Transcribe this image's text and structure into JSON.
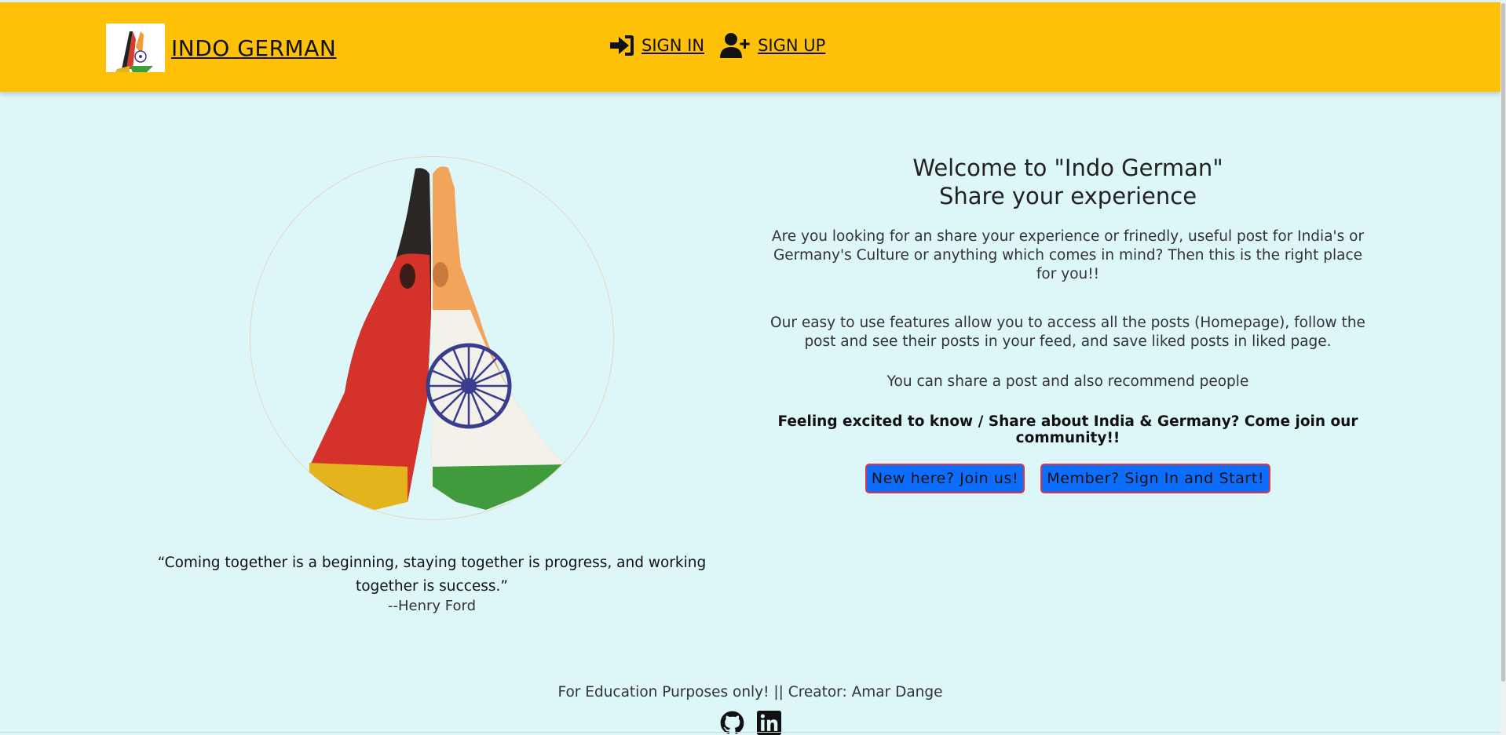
{
  "brand": {
    "name": "INDO GERMAN"
  },
  "nav": {
    "sign_in": "SIGN IN",
    "sign_up": "SIGN UP"
  },
  "quote": {
    "text": "“Coming together is a beginning, staying together is progress, and working together is success.”",
    "author": "--Henry Ford"
  },
  "welcome": {
    "line1": "Welcome to \"Indo German\"",
    "line2": "Share your experience",
    "intro": "Are you looking for an share your experience or frinedly, useful post for India's or Germany's Culture or anything which comes in mind? Then this is the right place for you!!",
    "features": "Our easy to use features allow you to access all the posts (Homepage), follow the post and see their posts in your feed, and save liked posts in liked page.",
    "share": "You can share a post and also recommend people",
    "excited": "Feeling excited to know / Share about India & Germany? Come join our community!!"
  },
  "buttons": {
    "join": "New here? Join us!",
    "signin": "Member? Sign In and Start!"
  },
  "footer": {
    "text": "For Education Purposes only! || Creator: Amar Dange"
  },
  "colors": {
    "navbar": "#ffc107",
    "background": "#ddf6f8",
    "button": "#0d6efd",
    "button_border": "#dc3545"
  },
  "icons": [
    "sign-in-icon",
    "user-plus-icon",
    "github-icon",
    "linkedin-icon"
  ]
}
